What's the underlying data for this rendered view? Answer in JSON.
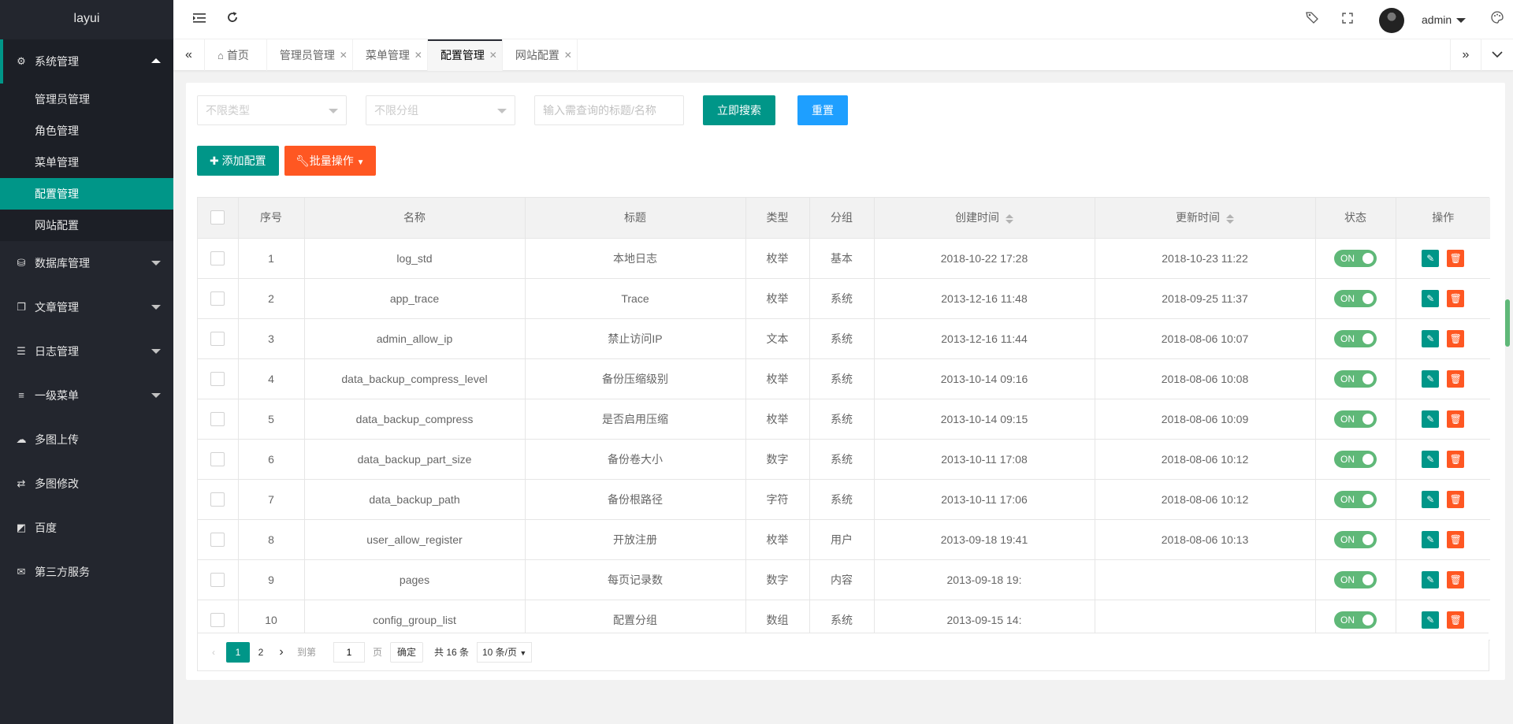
{
  "logo": "layui",
  "sidebar": {
    "group_open": {
      "label": "系统管理",
      "icon": "⚙"
    },
    "sub_items": [
      {
        "label": "管理员管理"
      },
      {
        "label": "角色管理"
      },
      {
        "label": "菜单管理"
      },
      {
        "label": "配置管理",
        "active": true
      },
      {
        "label": "网站配置"
      }
    ],
    "items": [
      {
        "label": "数据库管理",
        "icon": "⛁",
        "caret": true
      },
      {
        "label": "文章管理",
        "icon": "❐",
        "caret": true
      },
      {
        "label": "日志管理",
        "icon": "☰",
        "caret": true
      },
      {
        "label": "一级菜单",
        "icon": "≡",
        "caret": true
      },
      {
        "label": "多图上传",
        "icon": "☁",
        "caret": false
      },
      {
        "label": "多图修改",
        "icon": "⇄",
        "caret": false
      },
      {
        "label": "百度",
        "icon": "◩",
        "caret": false
      },
      {
        "label": "第三方服务",
        "icon": "✉",
        "caret": false
      }
    ]
  },
  "header": {
    "user": "admin"
  },
  "tabs": [
    {
      "label": "首页",
      "home": true,
      "closable": false
    },
    {
      "label": "管理员管理",
      "closable": true
    },
    {
      "label": "菜单管理",
      "closable": true
    },
    {
      "label": "配置管理",
      "closable": true,
      "active": true
    },
    {
      "label": "网站配置",
      "closable": true
    }
  ],
  "filters": {
    "type_select": "不限类型",
    "group_select": "不限分组",
    "search_placeholder": "输入需查询的标题/名称",
    "search_button": "立即搜索",
    "reset_button": "重置"
  },
  "toolbar": {
    "add_button": "添加配置",
    "batch_button": "批量操作"
  },
  "table": {
    "headers": [
      "序号",
      "名称",
      "标题",
      "类型",
      "分组",
      "创建时间",
      "更新时间",
      "状态",
      "操作"
    ],
    "switch_label": "ON",
    "rows": [
      {
        "id": "1",
        "name": "log_std",
        "title": "本地日志",
        "type": "枚举",
        "group": "基本",
        "created": "2018-10-22 17:28",
        "updated": "2018-10-23 11:22"
      },
      {
        "id": "2",
        "name": "app_trace",
        "title": "Trace",
        "type": "枚举",
        "group": "系统",
        "created": "2013-12-16 11:48",
        "updated": "2018-09-25 11:37"
      },
      {
        "id": "3",
        "name": "admin_allow_ip",
        "title": "禁止访问IP",
        "type": "文本",
        "group": "系统",
        "created": "2013-12-16 11:44",
        "updated": "2018-08-06 10:07"
      },
      {
        "id": "4",
        "name": "data_backup_compress_level",
        "title": "备份压缩级别",
        "type": "枚举",
        "group": "系统",
        "created": "2013-10-14 09:16",
        "updated": "2018-08-06 10:08"
      },
      {
        "id": "5",
        "name": "data_backup_compress",
        "title": "是否启用压缩",
        "type": "枚举",
        "group": "系统",
        "created": "2013-10-14 09:15",
        "updated": "2018-08-06 10:09"
      },
      {
        "id": "6",
        "name": "data_backup_part_size",
        "title": "备份卷大小",
        "type": "数字",
        "group": "系统",
        "created": "2013-10-11 17:08",
        "updated": "2018-08-06 10:12"
      },
      {
        "id": "7",
        "name": "data_backup_path",
        "title": "备份根路径",
        "type": "字符",
        "group": "系统",
        "created": "2013-10-11 17:06",
        "updated": "2018-08-06 10:12"
      },
      {
        "id": "8",
        "name": "user_allow_register",
        "title": "开放注册",
        "type": "枚举",
        "group": "用户",
        "created": "2013-09-18 19:41",
        "updated": "2018-08-06 10:13"
      },
      {
        "id": "9",
        "name": "pages",
        "title": "每页记录数",
        "type": "数字",
        "group": "内容",
        "created": "2013-09-18 19:",
        "updated": ""
      },
      {
        "id": "10",
        "name": "config_group_list",
        "title": "配置分组",
        "type": "数组",
        "group": "系统",
        "created": "2013-09-15 14:",
        "updated": ""
      }
    ]
  },
  "pager": {
    "pages": [
      "1",
      "2"
    ],
    "goto_label": "到第",
    "goto_value": "1",
    "page_unit": "页",
    "confirm": "确定",
    "total": "共 16 条",
    "per_page": "10 条/页"
  },
  "colors": {
    "accent": "#009688",
    "blue": "#1e9fff",
    "orange": "#ff5722",
    "switch_on": "#5fb878",
    "sidebar": "#23262e"
  }
}
